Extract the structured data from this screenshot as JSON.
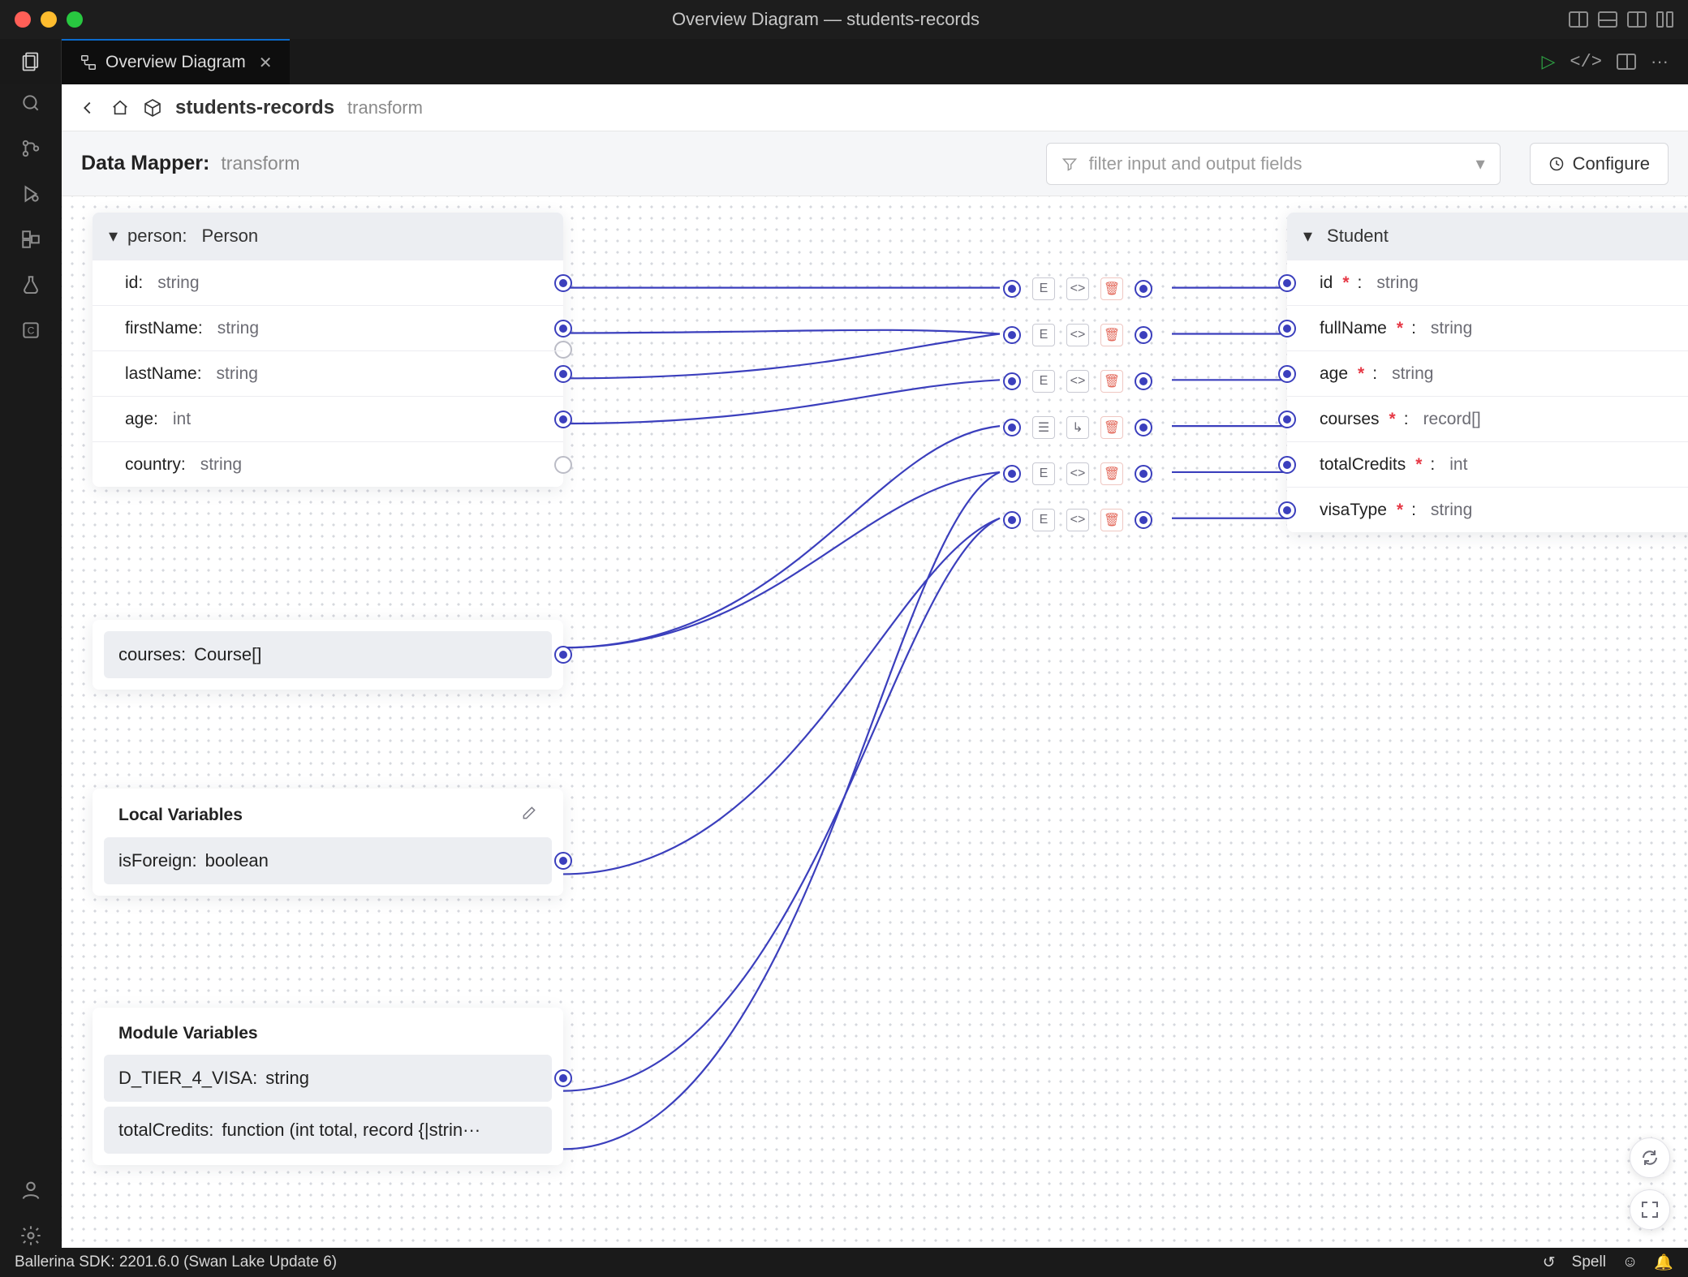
{
  "window_title": "Overview Diagram — students-records",
  "tab": {
    "label": "Overview Diagram"
  },
  "breadcrumb": {
    "project": "students-records",
    "func": "transform"
  },
  "dm_header": {
    "title": "Data Mapper:",
    "sub": "transform"
  },
  "filter": {
    "placeholder": "filter input and output fields"
  },
  "configure_label": "Configure",
  "input_main": {
    "head_name": "person:",
    "head_type": "Person",
    "fields": [
      {
        "name": "id:",
        "type": "string",
        "connected": true
      },
      {
        "name": "firstName:",
        "type": "string",
        "connected": true
      },
      {
        "name": "lastName:",
        "type": "string",
        "connected": true
      },
      {
        "name": "age:",
        "type": "int",
        "connected": true
      },
      {
        "name": "country:",
        "type": "string",
        "connected": false
      }
    ]
  },
  "courses_card": {
    "name": "courses:",
    "type": "Course[]"
  },
  "local_vars": {
    "title": "Local Variables",
    "vars": [
      {
        "name": "isForeign:",
        "type": "boolean"
      }
    ]
  },
  "module_vars": {
    "title": "Module Variables",
    "vars": [
      {
        "name": "D_TIER_4_VISA:",
        "type": "string"
      },
      {
        "name": "totalCredits:",
        "type": "function (int total, record {|strin···"
      }
    ]
  },
  "output": {
    "head": "Student",
    "fields": [
      {
        "name": "id",
        "type": "string"
      },
      {
        "name": "fullName",
        "type": "string"
      },
      {
        "name": "age",
        "type": "string"
      },
      {
        "name": "courses",
        "type": "record[]"
      },
      {
        "name": "totalCredits",
        "type": "int"
      },
      {
        "name": "visaType",
        "type": "string"
      }
    ]
  },
  "statusbar": {
    "sdk": "Ballerina SDK: 2201.6.0 (Swan Lake Update 6)",
    "spell": "Spell"
  }
}
